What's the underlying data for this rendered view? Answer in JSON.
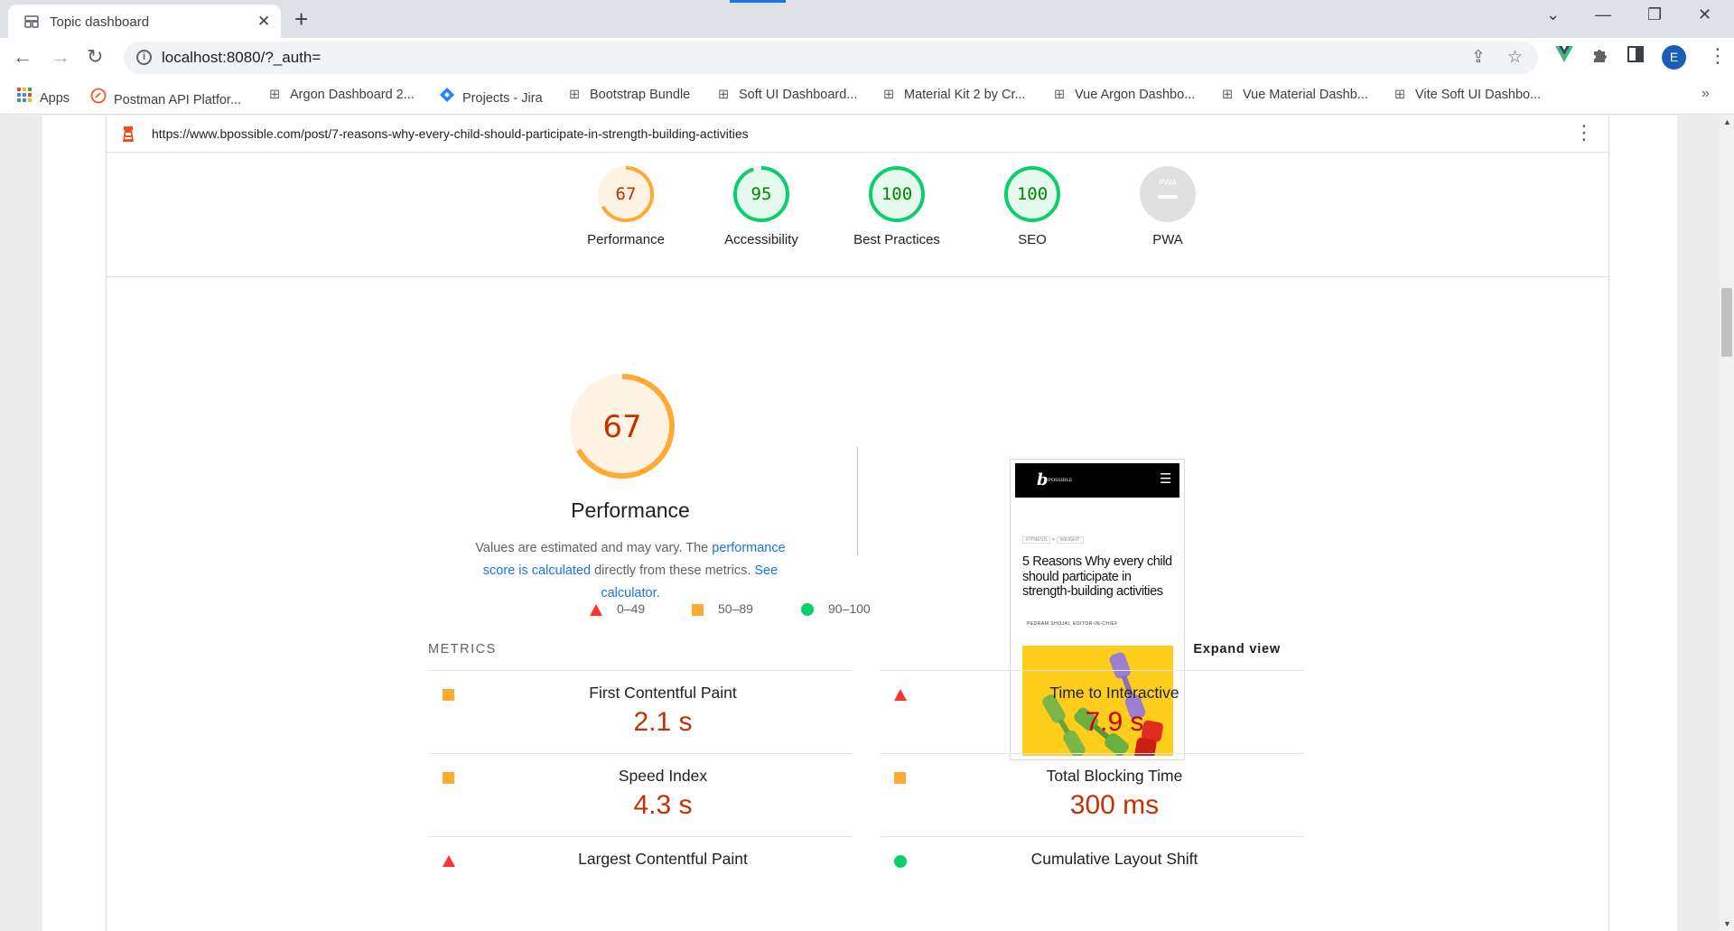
{
  "browser": {
    "tab_title": "Topic dashboard",
    "url": "localhost:8080/?_auth=",
    "avatar_letter": "E",
    "bookmarks": [
      {
        "label": "Apps",
        "icon": "apps-grid-icon"
      },
      {
        "label": "Postman API Platfor...",
        "icon": "postman-icon"
      },
      {
        "label": "Argon Dashboard 2...",
        "icon": "site-icon"
      },
      {
        "label": "Projects - Jira",
        "icon": "jira-icon"
      },
      {
        "label": "Bootstrap Bundle",
        "icon": "site-icon"
      },
      {
        "label": "Soft UI Dashboard...",
        "icon": "site-icon"
      },
      {
        "label": "Material Kit 2 by Cr...",
        "icon": "site-icon"
      },
      {
        "label": "Vue Argon Dashbo...",
        "icon": "site-icon"
      },
      {
        "label": "Vue Material Dashb...",
        "icon": "site-icon"
      },
      {
        "label": "Vite Soft UI Dashbo...",
        "icon": "site-icon"
      }
    ]
  },
  "report": {
    "page_url": "https://www.bpossible.com/post/7-reasons-why-every-child-should-participate-in-strength-building-activities",
    "categories": [
      {
        "label": "Performance",
        "score": "67",
        "score_value": 67,
        "status": "average"
      },
      {
        "label": "Accessibility",
        "score": "95",
        "score_value": 95,
        "status": "pass"
      },
      {
        "label": "Best Practices",
        "score": "100",
        "score_value": 100,
        "status": "pass"
      },
      {
        "label": "SEO",
        "score": "100",
        "score_value": 100,
        "status": "pass"
      },
      {
        "label": "PWA",
        "score": "PWA",
        "score_value": null,
        "status": "na"
      }
    ],
    "performance": {
      "score": "67",
      "score_value": 67,
      "title": "Performance",
      "desc_prefix": "Values are estimated and may vary. The ",
      "desc_link1": "performance score is calculated",
      "desc_middle": " directly from these metrics. ",
      "desc_link2": "See calculator.",
      "legend": [
        {
          "shape": "triangle",
          "range": "0–49",
          "color": "#ff3333"
        },
        {
          "shape": "square",
          "range": "50–89",
          "color": "#ffaa33"
        },
        {
          "shape": "circle",
          "range": "90–100",
          "color": "#0cce6b"
        }
      ]
    },
    "screenshot": {
      "logo": "b",
      "logo_small": "POSSIBLE",
      "crumb1": "FITNESS",
      "crumb_sep": ">",
      "crumb2": "WEIGHT",
      "title": "5 Reasons Why every child should participate in strength-building activities",
      "author": "PEDRAM SHOJAI, EDITOR-IN-CHIEF"
    },
    "metrics_title": "METRICS",
    "expand_label": "Expand view",
    "metrics": [
      {
        "name": "First Contentful Paint",
        "value": "2.1 s",
        "rating": "average"
      },
      {
        "name": "Time to Interactive",
        "value": "7.9 s",
        "rating": "fail"
      },
      {
        "name": "Speed Index",
        "value": "4.3 s",
        "rating": "average"
      },
      {
        "name": "Total Blocking Time",
        "value": "300 ms",
        "rating": "average"
      },
      {
        "name": "Largest Contentful Paint",
        "value": "",
        "rating": "fail"
      },
      {
        "name": "Cumulative Layout Shift",
        "value": "",
        "rating": "pass"
      }
    ]
  },
  "colors": {
    "fail": "#ff3333",
    "average": "#ffaa33",
    "pass": "#0cce6b",
    "fail_text": "#cc0000",
    "average_text": "#c33300",
    "pass_text": "#008800",
    "link": "#1a73e8"
  }
}
